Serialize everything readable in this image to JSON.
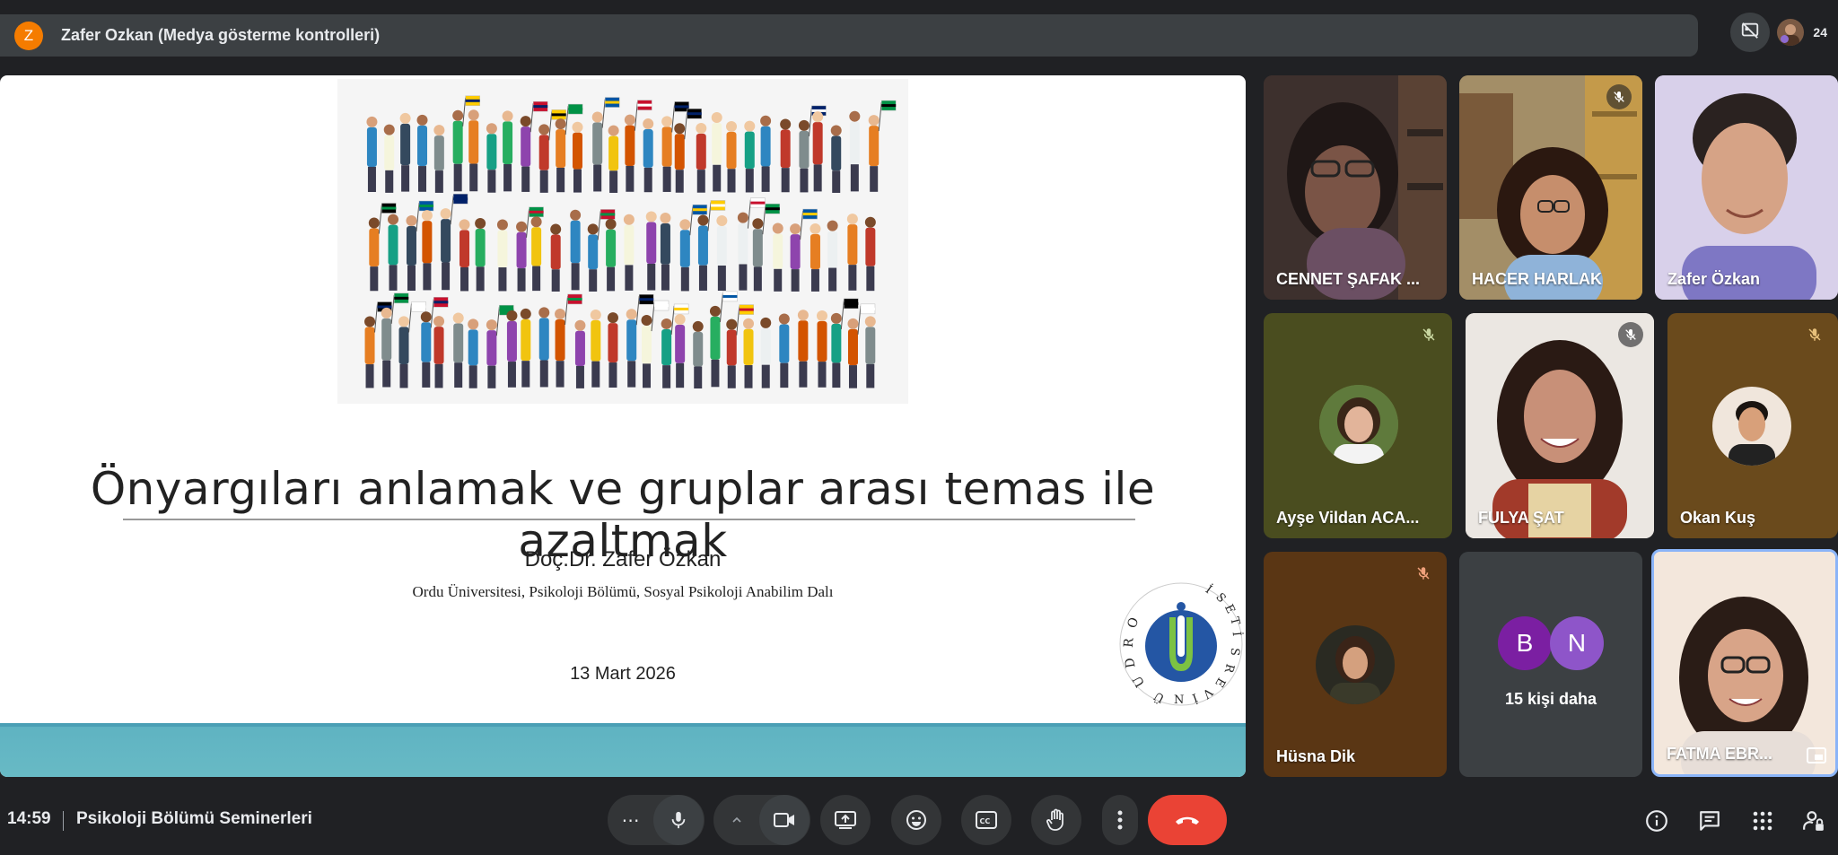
{
  "topbar": {
    "presenter_initial": "Z",
    "presenter_label": "Zafer Ozkan (Medya gösterme kontrolleri)",
    "participant_count": "24"
  },
  "slide": {
    "title": "Önyargıları anlamak ve gruplar arası temas ile azaltmak",
    "author": "Doç.Dr. Zafer Özkan",
    "affiliation": "Ordu Üniversitesi, Psikoloji Bölümü, Sosyal Psikoloji Anabilim Dalı",
    "date": "13 Mart 2026",
    "logo_text": "ORDU ÜNİVERSİTESİ"
  },
  "participants": [
    {
      "name": "CENNET ŞAFAK ...",
      "muted": false
    },
    {
      "name": "HACER HARLAK",
      "muted": true
    },
    {
      "name": "Zafer Özkan",
      "muted": false
    },
    {
      "name": "Ayşe Vildan ACA...",
      "muted": true
    },
    {
      "name": "FULYA ŞAT",
      "muted": true
    },
    {
      "name": "Okan Kuş",
      "muted": true
    },
    {
      "name": "Hüsna Dik",
      "muted": true
    },
    {
      "name": "FATMA EBR...",
      "muted": false
    }
  ],
  "more_tile": {
    "initials": [
      "B",
      "N"
    ],
    "label": "15 kişi daha"
  },
  "bottombar": {
    "time": "14:59",
    "meeting_name": "Psikoloji Bölümü Seminerleri"
  },
  "colors": {
    "background": "#202124",
    "end_call": "#ea4335",
    "control_bg": "#333537",
    "presenter_avatar": "#f57c00",
    "avatar_b": "#7b1fa2",
    "avatar_n": "#8e55c9",
    "active_speaker_border": "#8ab4f8"
  }
}
